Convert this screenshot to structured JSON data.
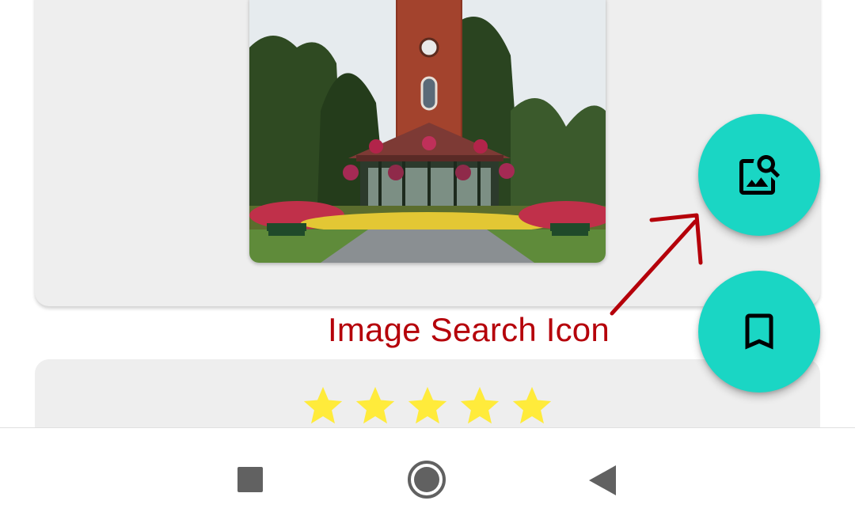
{
  "photo": {
    "description_icon": "bandstand-clock-tower-photo"
  },
  "fabs": {
    "image_search": {
      "icon": "image-search-icon",
      "color": "#1ad6c4"
    },
    "bookmark": {
      "icon": "bookmark-icon",
      "color": "#1ad6c4"
    }
  },
  "annotation": {
    "label": "Image Search Icon",
    "color": "#b5000a"
  },
  "rating": {
    "stars": 5,
    "max": 5,
    "color": "#ffeb3b"
  },
  "navbar": {
    "recents_icon": "square-icon",
    "home_icon": "circle-icon",
    "back_icon": "triangle-back-icon"
  }
}
